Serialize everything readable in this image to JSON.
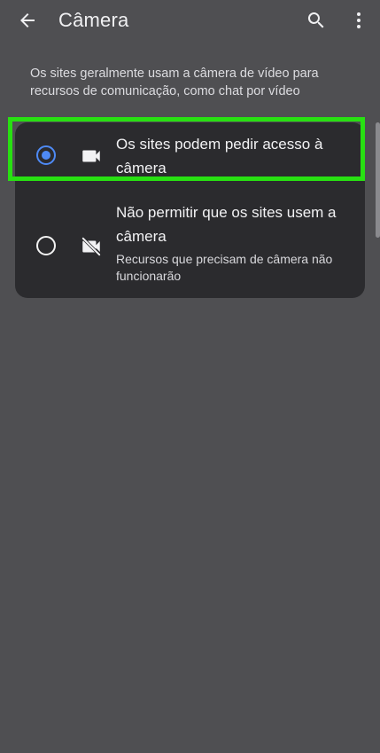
{
  "appbar": {
    "title": "Câmera",
    "back_icon": "arrow-back-icon",
    "search_icon": "search-icon",
    "more_icon": "more-vert-icon"
  },
  "description": "Os sites geralmente usam a câmera de vídeo para recursos de comunicação, como chat por vídeo",
  "options": [
    {
      "label": "Os sites podem pedir acesso à câmera",
      "selected": true,
      "icon": "videocam-icon"
    },
    {
      "label": "Não permitir que os sites usem a câmera",
      "sublabel": "Recursos que precisam de câmera não funcionarão",
      "selected": false,
      "icon": "videocam-off-icon"
    }
  ],
  "colors": {
    "background": "#4f4f52",
    "card": "#2b2b2e",
    "radio_selected": "#4e8af5",
    "highlight": "#28e012"
  }
}
